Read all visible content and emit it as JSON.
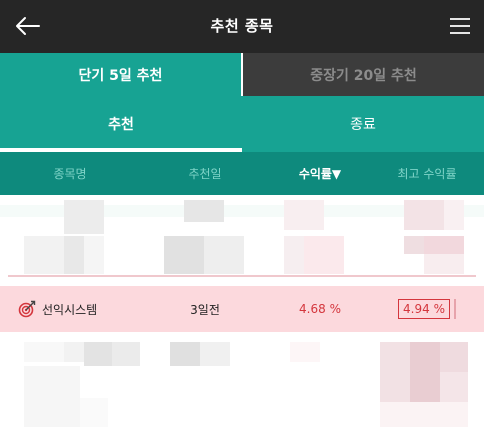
{
  "header": {
    "title": "추천 종목"
  },
  "period_tabs": [
    {
      "label": "단기 5일 추천",
      "active": true
    },
    {
      "label": "중장기 20일 추천",
      "active": false
    }
  ],
  "status_tabs": [
    {
      "label": "추천",
      "active": true
    },
    {
      "label": "종료",
      "active": false
    }
  ],
  "columns": {
    "name": "종목명",
    "date": "추천일",
    "return": "수익률▼",
    "max_return": "최고 수익률"
  },
  "highlighted_row": {
    "name": "선익시스템",
    "date": "3일전",
    "return": "4.68 %",
    "max_return": "4.94 %"
  },
  "colors": {
    "header_bg": "#262626",
    "accent": "#17a393",
    "column_header_bg": "#0e8a7d",
    "highlight_row_bg": "#fcd9dd",
    "positive_red": "#d4363d"
  },
  "icons": {
    "back": "arrow-left-icon",
    "menu": "hamburger-menu-icon",
    "stock": "target-icon"
  }
}
